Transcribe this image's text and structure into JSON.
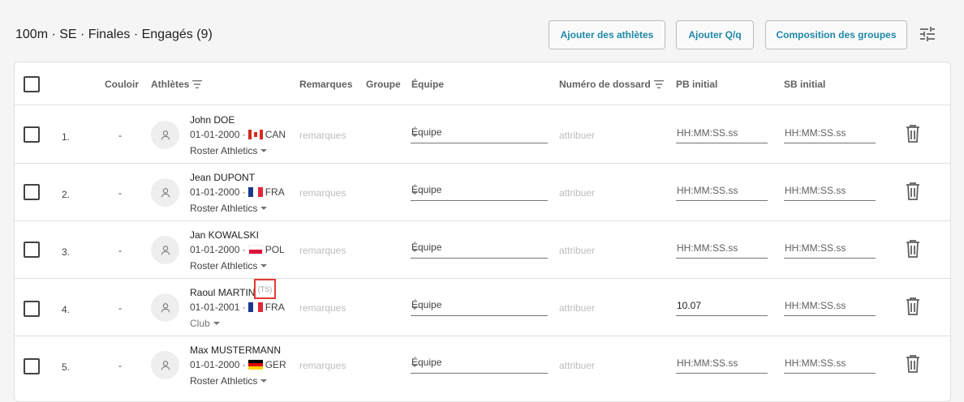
{
  "header": {
    "title": "100m · SE · Finales · Engagés (9)",
    "buttons": {
      "add_athletes": "Ajouter des athlètes",
      "add_q": "Ajouter Q/q",
      "groups": "Composition des groupes"
    }
  },
  "table": {
    "columns": {
      "lane": "Couloir",
      "athletes": "Athlètes",
      "remarks": "Remarques",
      "group": "Groupe",
      "team": "Équipe",
      "bib": "Numéro de dossard",
      "pb": "PB initial",
      "sb": "SB initial"
    },
    "rows": [
      {
        "num": "1.",
        "lane": "-",
        "name": "John DOE",
        "badge": "",
        "dob": "01-01-2000 ·",
        "country": "CAN",
        "flag": "canada",
        "club": "Roster Athletics",
        "remarks": "remarques",
        "team": "Équipe",
        "bib": "attribuer",
        "pb": "",
        "sb": ""
      },
      {
        "num": "2.",
        "lane": "-",
        "name": "Jean DUPONT",
        "badge": "",
        "dob": "01-01-2000 ·",
        "country": "FRA",
        "flag": "france",
        "club": "Roster Athletics",
        "remarks": "remarques",
        "team": "Équipe",
        "bib": "attribuer",
        "pb": "",
        "sb": ""
      },
      {
        "num": "3.",
        "lane": "-",
        "name": "Jan KOWALSKI",
        "badge": "",
        "dob": "01-01-2000 ·",
        "country": "POL",
        "flag": "poland",
        "club": "Roster Athletics",
        "remarks": "remarques",
        "team": "Équipe",
        "bib": "attribuer",
        "pb": "",
        "sb": ""
      },
      {
        "num": "4.",
        "lane": "-",
        "name": "Raoul MARTIN",
        "badge": "(TS)",
        "dob": "01-01-2001 ·",
        "country": "FRA",
        "flag": "france",
        "club": "Club",
        "remarks": "remarques",
        "team": "Équipe",
        "bib": "attribuer",
        "pb": "10.07",
        "sb": ""
      },
      {
        "num": "5.",
        "lane": "-",
        "name": "Max MUSTERMANN",
        "badge": "",
        "dob": "01-01-2000 ·",
        "country": "GER",
        "flag": "germany",
        "club": "Roster Athletics",
        "remarks": "remarques",
        "team": "Équipe",
        "bib": "attribuer",
        "pb": "",
        "sb": ""
      }
    ],
    "time_placeholder": "HH:MM:SS.ss"
  },
  "colors": {
    "accent": "#1e88a8",
    "highlight_border": "#e53935"
  }
}
